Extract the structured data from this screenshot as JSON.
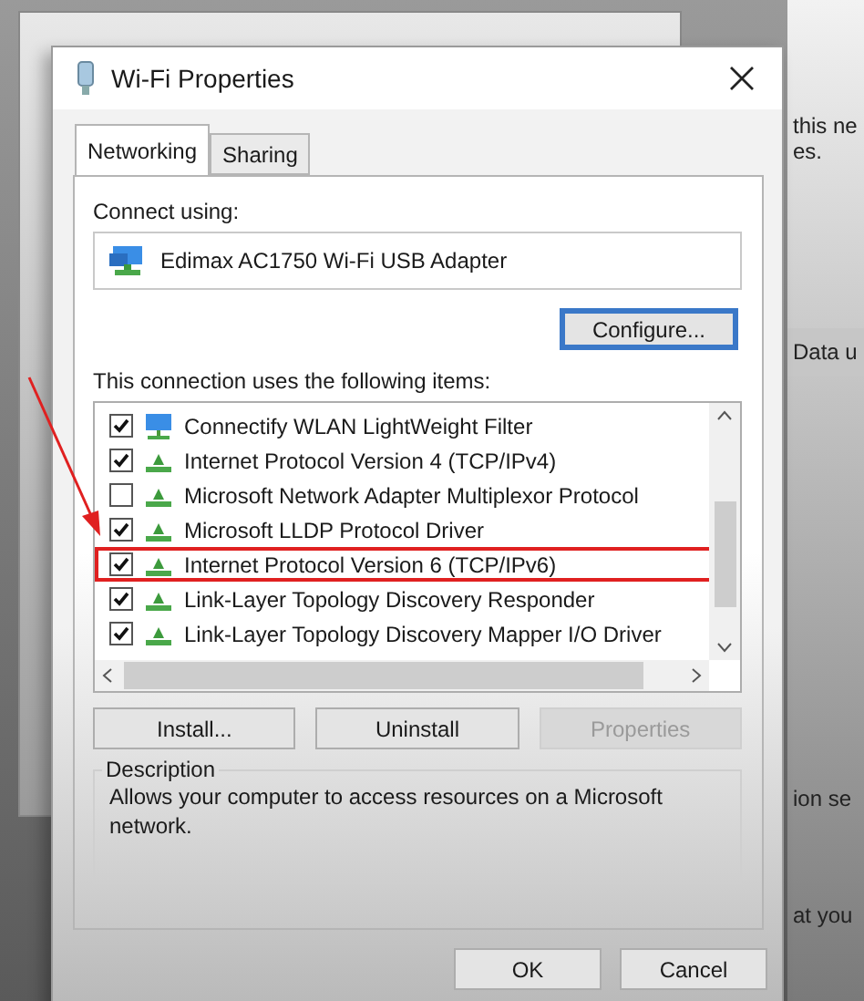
{
  "background": {
    "texts": [
      "this ne",
      "es.",
      "Data u",
      "ion se",
      "at you"
    ]
  },
  "dialog": {
    "title": "Wi-Fi Properties",
    "tabs": [
      {
        "label": "Networking",
        "selected": true
      },
      {
        "label": "Sharing",
        "selected": false
      }
    ],
    "connect_label": "Connect using:",
    "adapter": "Edimax AC1750 Wi-Fi USB Adapter",
    "configure_button": "Configure...",
    "items_label": "This connection uses the following items:",
    "items": [
      {
        "label": "Connectify WLAN LightWeight Filter",
        "checked": true,
        "kind": "filter",
        "highlighted": false
      },
      {
        "label": "Internet Protocol Version 4 (TCP/IPv4)",
        "checked": true,
        "kind": "protocol",
        "highlighted": false
      },
      {
        "label": "Microsoft Network Adapter Multiplexor Protocol",
        "checked": false,
        "kind": "protocol",
        "highlighted": false
      },
      {
        "label": "Microsoft LLDP Protocol Driver",
        "checked": true,
        "kind": "protocol",
        "highlighted": false
      },
      {
        "label": "Internet Protocol Version 6 (TCP/IPv6)",
        "checked": true,
        "kind": "protocol",
        "highlighted": true
      },
      {
        "label": "Link-Layer Topology Discovery Responder",
        "checked": true,
        "kind": "protocol",
        "highlighted": false
      },
      {
        "label": "Link-Layer Topology Discovery Mapper I/O Driver",
        "checked": true,
        "kind": "protocol",
        "highlighted": false
      }
    ],
    "buttons": [
      {
        "label": "Install...",
        "disabled": false
      },
      {
        "label": "Uninstall",
        "disabled": false
      },
      {
        "label": "Properties",
        "disabled": true
      }
    ],
    "description": {
      "legend": "Description",
      "text": "Allows your computer to access resources on a Microsoft network."
    },
    "footer_buttons": [
      "OK",
      "Cancel"
    ]
  }
}
